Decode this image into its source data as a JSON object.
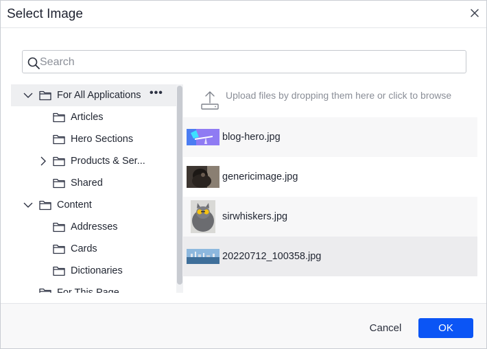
{
  "dialog": {
    "title": "Select Image",
    "close_icon": "close-icon"
  },
  "search": {
    "placeholder": "Search",
    "value": "",
    "icon": "search-icon"
  },
  "tree": {
    "items": [
      {
        "label": "For All Applications",
        "expanded": true,
        "selected": true,
        "has_menu": true,
        "menu_label": "•••"
      },
      {
        "label": "Articles"
      },
      {
        "label": "Hero Sections"
      },
      {
        "label": "Products & Ser...",
        "expanded": false
      },
      {
        "label": "Shared"
      },
      {
        "label": "Content",
        "expanded": true
      },
      {
        "label": "Addresses"
      },
      {
        "label": "Cards"
      },
      {
        "label": "Dictionaries"
      },
      {
        "label": "For This Page"
      }
    ]
  },
  "upload": {
    "text": "Upload files by dropping them here or click to browse",
    "icon": "upload-icon"
  },
  "files": [
    {
      "name": "blog-hero.jpg"
    },
    {
      "name": "genericimage.jpg"
    },
    {
      "name": "sirwhiskers.jpg"
    },
    {
      "name": "20220712_100358.jpg",
      "selected": true
    }
  ],
  "footer": {
    "cancel_label": "Cancel",
    "ok_label": "OK"
  },
  "colors": {
    "primary": "#0b55f5",
    "selected_bg": "#eeeff1",
    "border": "#c9ccd2"
  }
}
